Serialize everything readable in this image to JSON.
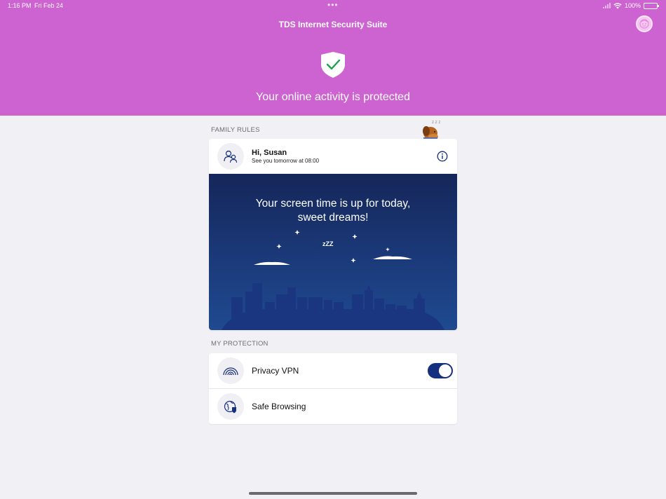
{
  "status_bar": {
    "time": "1:16 PM",
    "date": "Fri Feb 24",
    "dots": "•••",
    "battery": "100%"
  },
  "header": {
    "title": "TDS Internet Security Suite",
    "status_message": "Your online activity is protected"
  },
  "family_rules": {
    "section_label": "FAMILY RULES",
    "greeting": "Hi, Susan",
    "subtitle": "See you tomorrow at 08:00",
    "screen_time_message_line1": "Your screen time is up for today,",
    "screen_time_message_line2": "sweet dreams!",
    "moon_text": "zZZ"
  },
  "my_protection": {
    "section_label": "MY PROTECTION",
    "items": [
      {
        "label": "Privacy VPN",
        "icon": "vpn-rainbow-icon",
        "toggle_on": true
      },
      {
        "label": "Safe Browsing",
        "icon": "globe-shield-icon"
      }
    ]
  },
  "colors": {
    "header": "#cd62d1",
    "accent": "#14307e",
    "night_sky": "#1b3a7a",
    "shield_check": "#1fa04a"
  }
}
